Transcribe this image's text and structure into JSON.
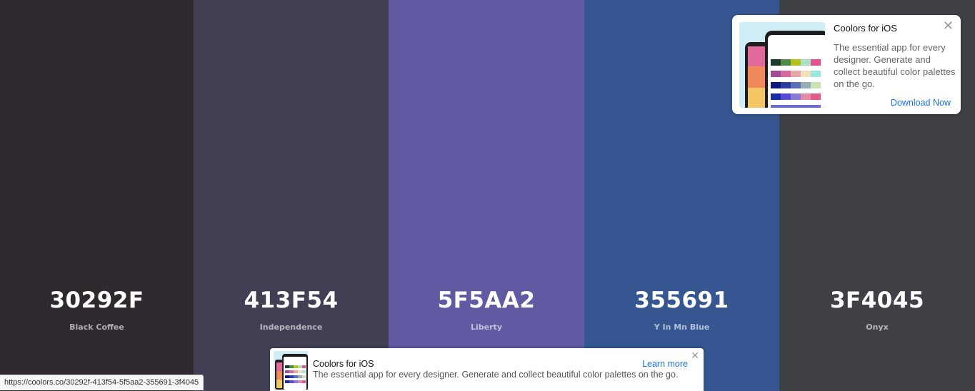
{
  "palette": {
    "colors": [
      {
        "hex": "30292F",
        "name": "Black Coffee",
        "color": "#30292f"
      },
      {
        "hex": "413F54",
        "name": "Independence",
        "color": "#413f54"
      },
      {
        "hex": "5F5AA2",
        "name": "Liberty",
        "color": "#5f5aa2"
      },
      {
        "hex": "355691",
        "name": "Y In Mn Blue",
        "color": "#355691"
      },
      {
        "hex": "3F4045",
        "name": "Onyx",
        "color": "#3f4045"
      }
    ]
  },
  "ad_card": {
    "title": "Coolors for iOS",
    "description": "The essential app for every designer. Generate and collect beautiful color palettes on the go.",
    "cta": "Download Now",
    "close_icon": "close-icon"
  },
  "ad_banner": {
    "title": "Coolors for iOS",
    "description": "The essential app for every designer. Generate and collect beautiful color palettes on the go.",
    "cta": "Learn more",
    "close_icon": "close-icon"
  },
  "status_bar": {
    "url": "https://coolors.co/30292f-413f54-5f5aa2-355691-3f4045"
  }
}
